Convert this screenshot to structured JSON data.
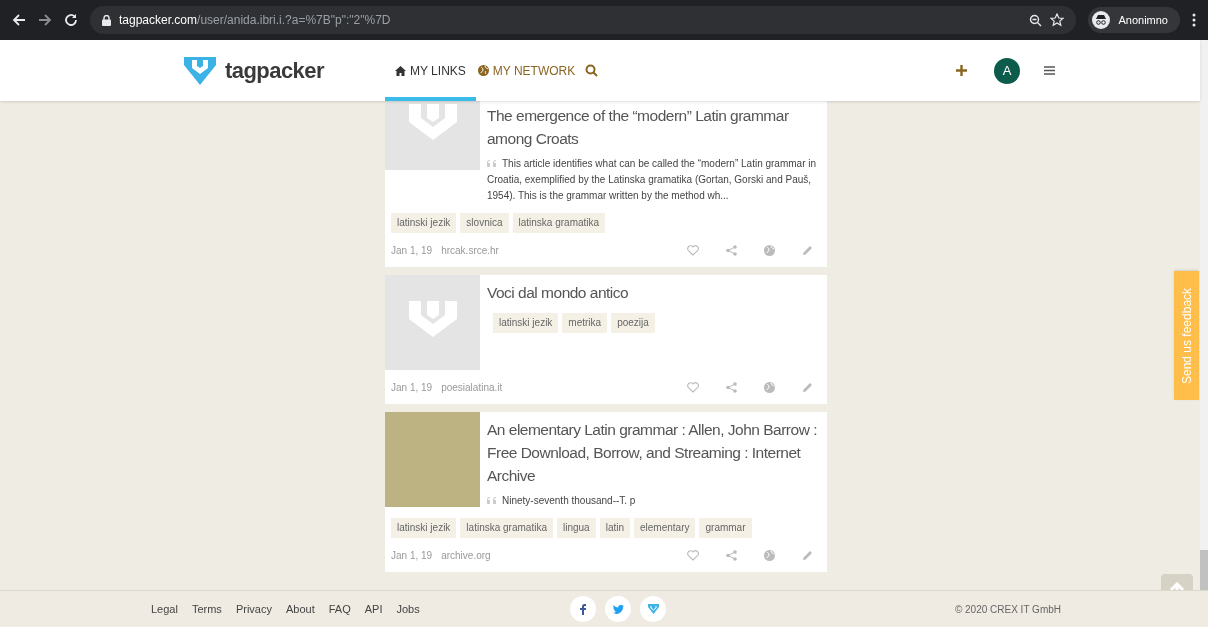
{
  "browser": {
    "url_host": "tagpacker.com",
    "url_path": "/user/anida.ibri.i.?a=%7B\"p\":\"2\"%7D",
    "profile": "Anonimno"
  },
  "header": {
    "logo": "tagpacker",
    "nav": [
      {
        "label": "MY LINKS",
        "kind": "home",
        "selected": true
      },
      {
        "label": "MY NETWORK",
        "kind": "globe",
        "selected": false
      }
    ],
    "avatar": "A"
  },
  "cards": [
    {
      "kind": "placeholder",
      "title": "The emergence of the “modern” Latin grammar among Croats",
      "description": "This article identifies what can be called the “modern” Latin grammar in Croatia, exemplified by the Latinska gramatika (Gortan, Gorski and Pauš, 1954). This is the grammar written by the method wh...",
      "tags": [
        "latinski jezik",
        "slovnica",
        "latinska gramatika"
      ],
      "date": "Jan 1, 19",
      "source": "hrcak.srce.hr"
    },
    {
      "kind": "placeholder",
      "title": "Voci dal mondo antico",
      "tags": [
        "latinski jezik",
        "metrika",
        "poezija"
      ],
      "date": "Jan 1, 19",
      "source": "poesialatina.it"
    },
    {
      "kind": "photo",
      "title": "An elementary Latin grammar : Allen, John Barrow : Free Download, Borrow, and Streaming : Internet Archive",
      "description": "Ninety-seventh thousand--T. p",
      "tags": [
        "latinski jezik",
        "latinska gramatika",
        "lingua",
        "latin",
        "elementary",
        "grammar"
      ],
      "date": "Jan 1, 19",
      "source": "archive.org"
    }
  ],
  "feedback": "Send us feedback",
  "footer": {
    "links": [
      "Legal",
      "Terms",
      "Privacy",
      "About",
      "FAQ",
      "API",
      "Jobs"
    ],
    "social": [
      {
        "kind": "facebook"
      },
      {
        "kind": "twitter"
      },
      {
        "kind": "tagpacker"
      }
    ],
    "copyright": "© 2020 CREX IT GmbH"
  }
}
